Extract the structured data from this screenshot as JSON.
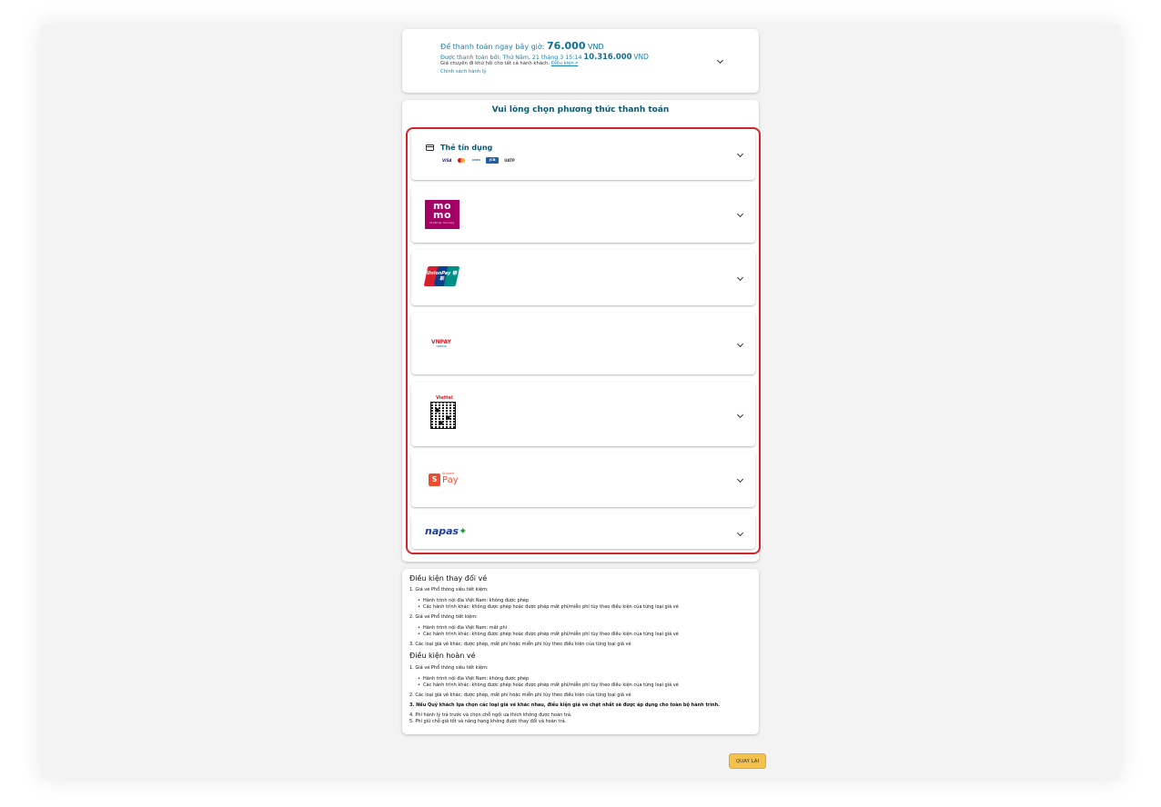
{
  "summary": {
    "pay_now_label": "Để thanh toán ngay bây giờ:",
    "pay_now_amount": "76.000",
    "pay_now_currency": "VND",
    "pay_later_label": "Được thanh toán bởi: Thứ Năm, 21 tháng 3 15:14",
    "pay_later_amount": "10.316.000",
    "pay_later_currency": "VND",
    "refund_note": "Giá chuyến đi khứ hồi cho tất cả hành khách.",
    "conditions_link": "Điều kiện",
    "baggage_policy_link": "Chính sách hành lý",
    "expand_icon": "chevron-down-icon"
  },
  "payment": {
    "title": "Vui lòng chọn phương thức thanh toán",
    "credit_card_label": "Thẻ tín dụng",
    "card_brands": [
      "VISA",
      "",
      "AMEX",
      "JCB",
      "UATP"
    ],
    "methods": [
      "Thẻ tín dụng",
      "MoMo",
      "UnionPay",
      "VNPAY",
      "Viettel Money",
      "ShopeePay",
      "napas"
    ],
    "momo_logo_text": "mo mo",
    "momo_sub": "mobile money",
    "unionpay_logo_text": "UnionPay 银联",
    "vnpay_logo_text": "VNPAY",
    "vnpay_sub": "VNPAYQR",
    "viettel_logo_text": "Viettel",
    "shopee_logo_text": "Shopee",
    "shopee_pay_text": "Pay",
    "napas_logo_text": "napas",
    "accent_color": "#0b5a72",
    "highlight_color": "#d0262a"
  },
  "conditions": {
    "change_title": "Điều kiện thay đổi vé",
    "change_items": [
      "1. Giá vé Phổ thông siêu tiết kiệm:",
      "Hành trình nội địa Việt Nam: không được phép",
      "Các hành trình khác: không được phép hoặc được phép mất phí/miễn phí tùy theo điều kiện của từng loại giá vé",
      "2. Giá vé Phổ thông tiết kiệm:",
      "Hành trình nội địa Việt Nam: mất phí",
      "Các hành trình khác: không được phép hoặc được phép mất phí/miễn phí tùy theo điều kiện của từng loại giá vé",
      "3. Các loại giá vé khác: được phép, mất phí hoặc miễn phí tùy theo điều kiện của từng loại giá vé"
    ],
    "refund_title": "Điều kiện hoàn vé",
    "refund_items": [
      "1. Giá vé Phổ thông siêu tiết kiệm:",
      "Hành trình nội địa Việt Nam: không được phép",
      "Các hành trình khác: không được phép hoặc được phép mất phí/miễn phí tùy theo điều kiện của từng loại giá vé",
      "2. Các loại giá vé khác: được phép, mất phí hoặc miễn phí tùy theo điều kiện của từng loại giá vé",
      "3. Nếu Quý khách lựa chọn các loại giá vé khác nhau, điều kiện giá vé chặt nhất sẽ được áp dụng cho toàn bộ hành trình.",
      "4. Phí hành lý trả trước và chọn chỗ ngồi ưa thích không được hoàn trả.",
      "5. Phí giữ chỗ giá tốt và nâng hạng không được thay đổi và hoàn trả."
    ]
  },
  "back_button": {
    "label": "QUAY LẠI",
    "color": "#f2c14e"
  }
}
